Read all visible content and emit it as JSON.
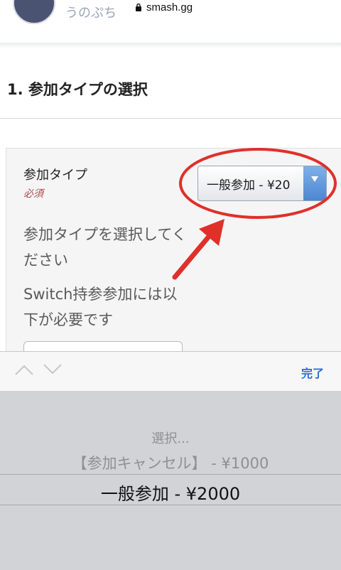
{
  "browser": {
    "url": "smash.gg"
  },
  "header": {
    "host_name": "うのぷち"
  },
  "section": {
    "title": "1. 参加タイプの選択"
  },
  "form": {
    "field_label": "参加タイプ",
    "required": "必須",
    "help_text_1": "参加タイプを選択してください",
    "help_text_2": "Switch持参参加には以下が必要です",
    "select_value": "一般参加 - ¥20"
  },
  "toolbar": {
    "done_label": "完了"
  },
  "picker": {
    "options": [
      "選択...",
      "【参加キャンセル】 - ¥1000",
      "一般参加 - ¥2000"
    ],
    "selected_index": 2
  },
  "colors": {
    "annotation_red": "#e0302a",
    "accent_blue": "#2a6ad8",
    "required_red": "#b04a4a"
  }
}
